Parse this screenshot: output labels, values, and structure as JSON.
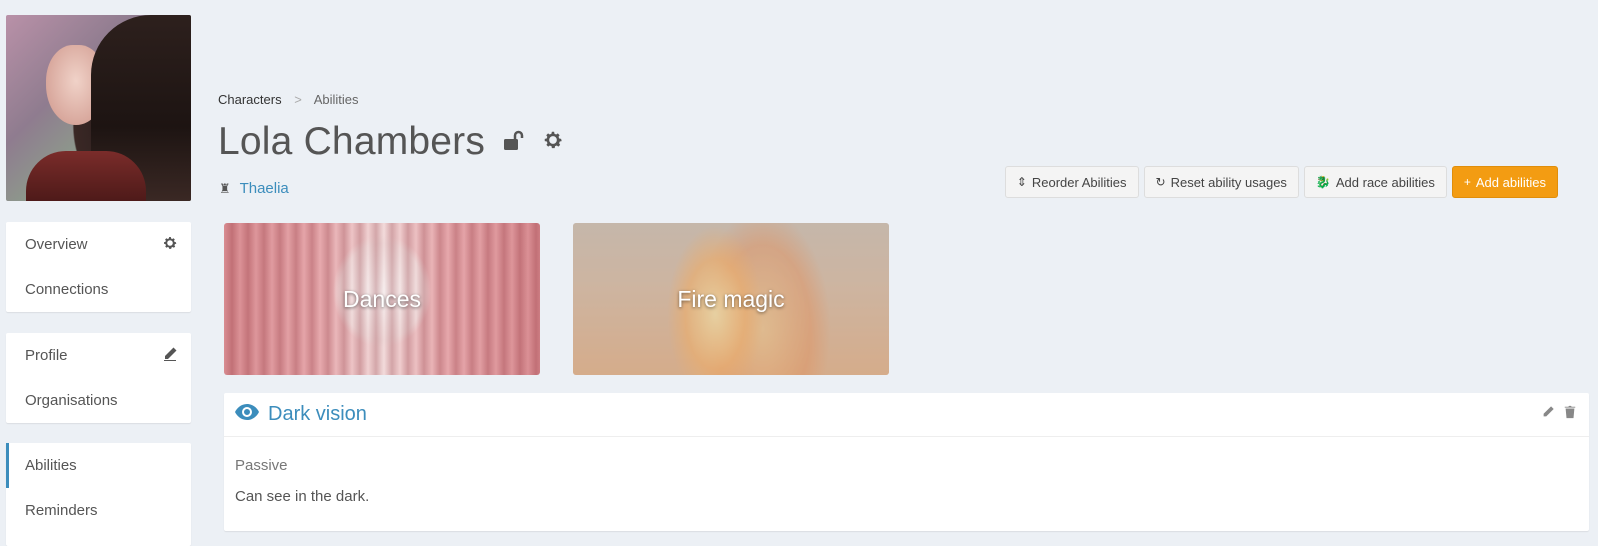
{
  "breadcrumb": {
    "characters": "Characters",
    "separator": ">",
    "current": "Abilities"
  },
  "character": {
    "name": "Lola Chambers",
    "location": "Thaelia"
  },
  "sidebar": {
    "group1": [
      {
        "label": "Overview",
        "icon": "gear-icon"
      },
      {
        "label": "Connections"
      }
    ],
    "group2": [
      {
        "label": "Profile",
        "icon": "pencil-icon"
      },
      {
        "label": "Organisations"
      }
    ],
    "group3": [
      {
        "label": "Abilities",
        "active": true
      },
      {
        "label": "Reminders"
      }
    ]
  },
  "toolbar": {
    "reorder": "Reorder Abilities",
    "reset": "Reset ability usages",
    "race": "Add race abilities",
    "add": "Add abilities"
  },
  "ability_cards": [
    {
      "name": "Dances"
    },
    {
      "name": "Fire magic"
    }
  ],
  "ability_detail": {
    "title": "Dark vision",
    "type": "Passive",
    "description": "Can see in the dark."
  },
  "colors": {
    "accent": "#3c8dbc",
    "primary_button": "#f39c12",
    "background": "#ecf0f5"
  }
}
